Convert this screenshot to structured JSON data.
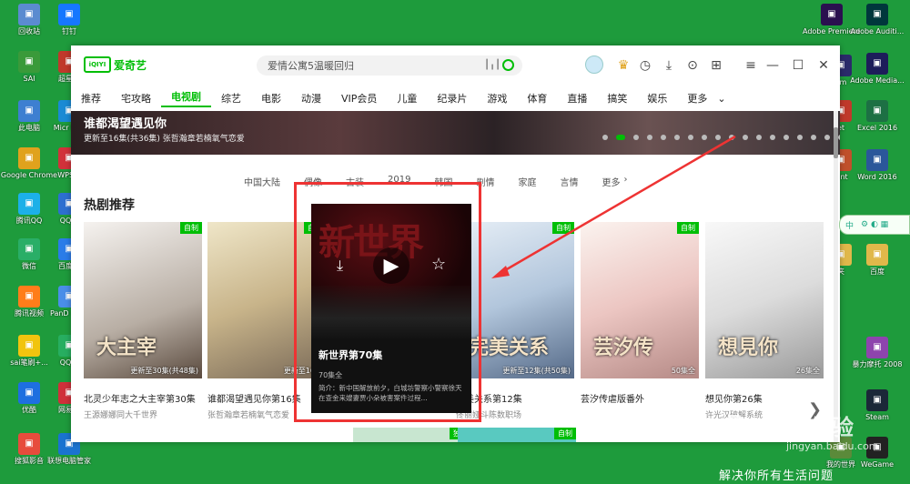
{
  "desktop_left": [
    {
      "label": "回收站",
      "color": "#5b8bd0"
    },
    {
      "label": "钉钉",
      "color": "#1677ff"
    },
    {
      "label": "SAI",
      "color": "#3a9a3a"
    },
    {
      "label": "超星网",
      "color": "#c0392b"
    },
    {
      "label": "此电脑",
      "color": "#3d7fd1"
    },
    {
      "label": "Micr Edg",
      "color": "#1a8ad4"
    },
    {
      "label": "Google Chrome",
      "color": "#e0a21d"
    },
    {
      "label": "WPS 2",
      "color": "#d1323a"
    },
    {
      "label": "腾讯QQ",
      "color": "#1cb0e8"
    },
    {
      "label": "QQ浏",
      "color": "#2d6fd0"
    },
    {
      "label": "微信",
      "color": "#2aae67"
    },
    {
      "label": "百度网",
      "color": "#2a7ce8"
    },
    {
      "label": "腾讯视频",
      "color": "#ff7d1a"
    },
    {
      "label": "PanD -快捷",
      "color": "#4a8ee8"
    },
    {
      "label": "sai笔刷+...",
      "color": "#f1c40f"
    },
    {
      "label": "QQ音",
      "color": "#27ae60"
    },
    {
      "label": "优酷",
      "color": "#1e6fe0"
    },
    {
      "label": "网易云",
      "color": "#d0303a"
    },
    {
      "label": "搜狐影音",
      "color": "#e74c3c"
    },
    {
      "label": "联想电脑管家",
      "color": "#1a73d0"
    }
  ],
  "desktop_right": [
    {
      "label": "Adobe Premiere...",
      "color": "#2a0f4f"
    },
    {
      "label": "Adobe Auditi...",
      "color": "#00373c"
    },
    {
      "label": "om",
      "color": "#2a2a6a"
    },
    {
      "label": "Adobe Media...",
      "color": "#1d1d5a"
    },
    {
      "label": "et",
      "color": "#c0392b"
    },
    {
      "label": "Excel 2016",
      "color": "#1d7044"
    },
    {
      "label": "oint",
      "color": "#c0502b"
    },
    {
      "label": "Word 2016",
      "color": "#2b579a"
    },
    {
      "label": "夹",
      "color": "#e0b84a"
    },
    {
      "label": "百度",
      "color": "#e0b84a"
    },
    {
      "label": "暴力摩托 2008",
      "color": "#8e44ad"
    },
    {
      "label": "Steam",
      "color": "#1b2838"
    },
    {
      "label": "我的世界",
      "color": "#5b8a3a"
    },
    {
      "label": "WeGame",
      "color": "#222222"
    }
  ],
  "app": {
    "logo_text": "爱奇艺",
    "logo_mark": "iQIYI",
    "search_placeholder": "爱情公寓5温暖回归",
    "nav": [
      "推荐",
      "宅攻略",
      "电视剧",
      "综艺",
      "电影",
      "动漫",
      "VIP会员",
      "儿童",
      "纪录片",
      "游戏",
      "体育",
      "直播",
      "搞笑",
      "娱乐",
      "更多"
    ],
    "nav_active": "电视剧",
    "banner_title": "谁都渴望遇见你",
    "banner_subtitle": "更新至16集(共36集) 张哲瀚章若楠氧气恋爱",
    "banner_dots": 18,
    "categories": [
      "中国大陆",
      "偶像",
      "古装",
      "2019",
      "韩国",
      "剧情",
      "家庭",
      "言情",
      "更多"
    ],
    "section_title": "热剧推荐",
    "cards": [
      {
        "title": "北灵少年志之大主宰第30集",
        "desc": "王源娜娜同大千世界",
        "episodes": "更新至30集(共48集)",
        "tag": "自制",
        "poster_text": "大主宰"
      },
      {
        "title": "谁都渴望遇见你第16集",
        "desc": "张哲瀚章若楠氧气恋爱",
        "episodes": "更新至16集",
        "tag": "自制",
        "poster_text": ""
      },
      {
        "title": "完美关系第12集",
        "desc": "佟丽娅斗陈数职场",
        "episodes": "更新至12集(共50集)",
        "tag": "自制",
        "poster_text": "完美关系"
      },
      {
        "title": "芸汐传虐版番外",
        "desc": "",
        "episodes": "50集全",
        "tag": "自制",
        "poster_text": "芸汐传"
      },
      {
        "title": "想见你第26集",
        "desc": "许光汉破解系统",
        "episodes": "26集全",
        "tag": "",
        "poster_text": "想見你"
      }
    ],
    "row2_tags": [
      "独播",
      "自制"
    ],
    "popup": {
      "title": "新世界第70集",
      "episodes": "70集全",
      "desc": "简介：新中国解放前夕，白城坊警察小警察徐天在查金来嫂妻贾小朵被害案件过程..."
    }
  },
  "ime_label": "中",
  "watermark": {
    "brand": "Bai",
    "brand2": "经验",
    "url": "jingyan.baidu.com",
    "slogan": "解决你所有生活问题"
  }
}
